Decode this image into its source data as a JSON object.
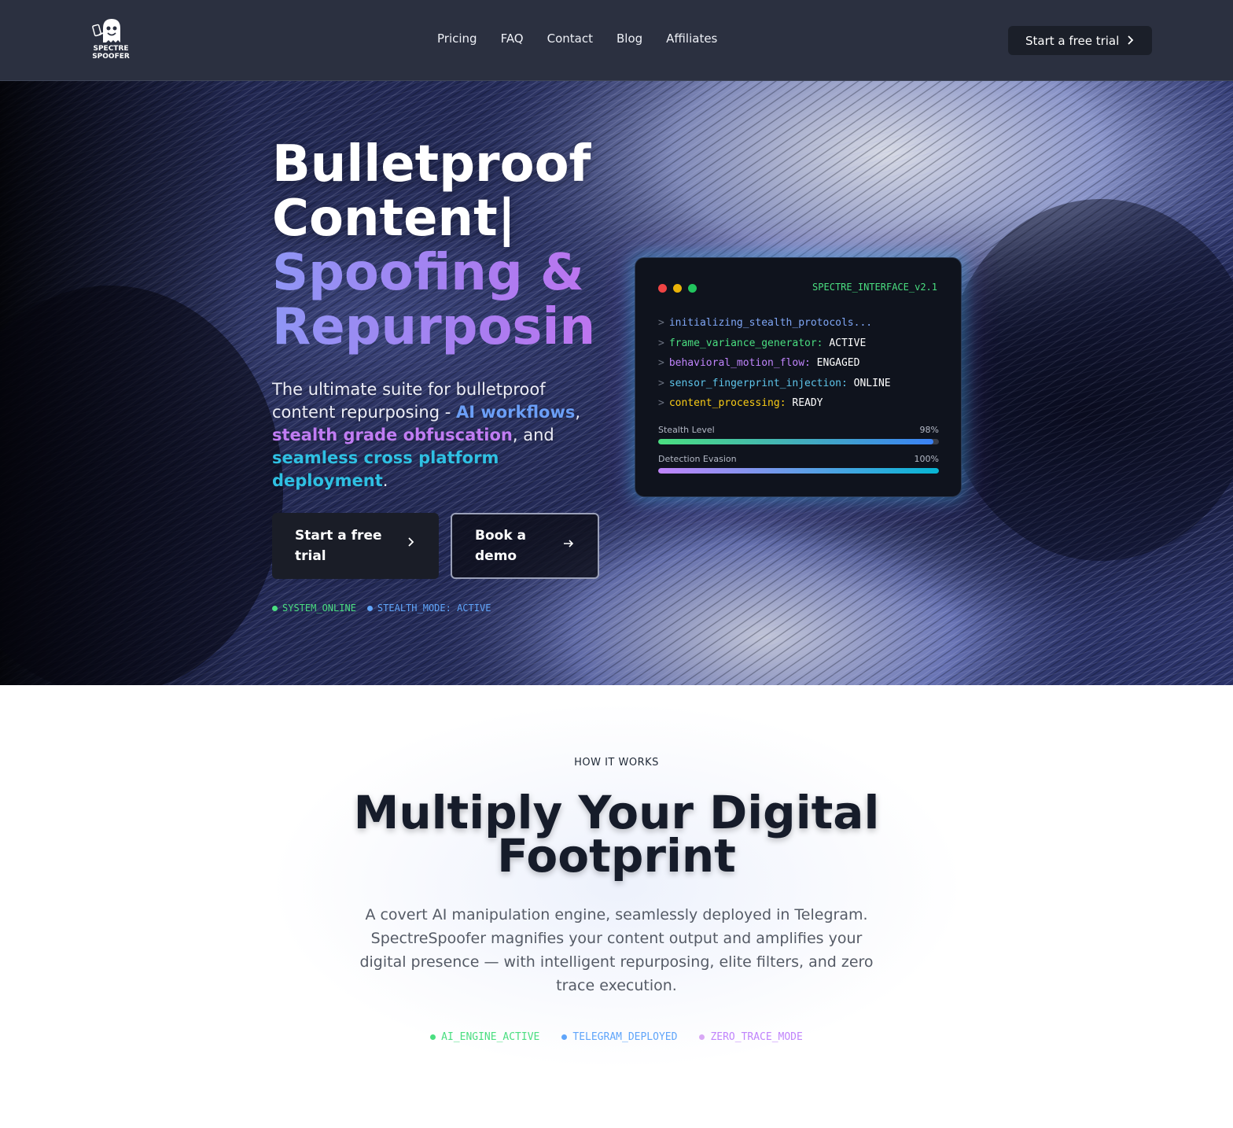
{
  "brand": {
    "logo_line1": "SPECTRE",
    "logo_line2": "SPOOFER"
  },
  "nav": {
    "links": [
      "Pricing",
      "FAQ",
      "Contact",
      "Blog",
      "Affiliates"
    ],
    "cta": "Start a free trial"
  },
  "hero": {
    "title_line1": "Bulletproof",
    "title_line2": "Content|",
    "title_line3": "Spoofing &",
    "title_line4": "Repurposin",
    "subtitle_part1": "The ultimate suite for bulletproof content repurposing - ",
    "subtitle_highlight1": "AI workflows",
    "subtitle_part2": ", ",
    "subtitle_highlight2": "stealth grade obfuscation",
    "subtitle_part3": ", and ",
    "subtitle_highlight3": "seamless cross platform deployment",
    "subtitle_part4": ".",
    "primary_button": "Start a free trial",
    "secondary_button": "Book a demo",
    "status": [
      {
        "label": "SYSTEM_ONLINE",
        "color": "#4ade80"
      },
      {
        "label": "STEALTH_MODE: ACTIVE",
        "color": "#60a5fa"
      }
    ]
  },
  "terminal": {
    "title": "SPECTRE_INTERFACE_v2.1",
    "lines": [
      {
        "prompt": ">",
        "key": "initializing_stealth_protocols...",
        "value": "",
        "color": "#7fa6f5"
      },
      {
        "prompt": ">",
        "key": "frame_variance_generator:",
        "value": "ACTIVE",
        "color": "#4ade80"
      },
      {
        "prompt": ">",
        "key": "behavioral_motion_flow:",
        "value": "ENGAGED",
        "color": "#c084fc"
      },
      {
        "prompt": ">",
        "key": "sensor_fingerprint_injection:",
        "value": "ONLINE",
        "color": "#5ec5ea"
      },
      {
        "prompt": ">",
        "key": "content_processing:",
        "value": "READY",
        "color": "#facc15"
      }
    ],
    "meters": [
      {
        "label": "Stealth Level",
        "value_text": "98%",
        "value": 98
      },
      {
        "label": "Detection Evasion",
        "value_text": "100%",
        "value": 100
      }
    ]
  },
  "how": {
    "eyebrow": "HOW IT WORKS",
    "title": "Multiply Your Digital Footprint",
    "paragraph": "A covert AI manipulation engine, seamlessly deployed in Telegram. SpectreSpoofer magnifies your content output and amplifies your digital presence — with intelligent repurposing, elite filters, and zero trace execution.",
    "tags": [
      {
        "label": "AI_ENGINE_ACTIVE",
        "color": "#4ade80"
      },
      {
        "label": "TELEGRAM_DEPLOYED",
        "color": "#60a5fa"
      },
      {
        "label": "ZERO_TRACE_MODE",
        "color": "#c084fc"
      }
    ]
  }
}
